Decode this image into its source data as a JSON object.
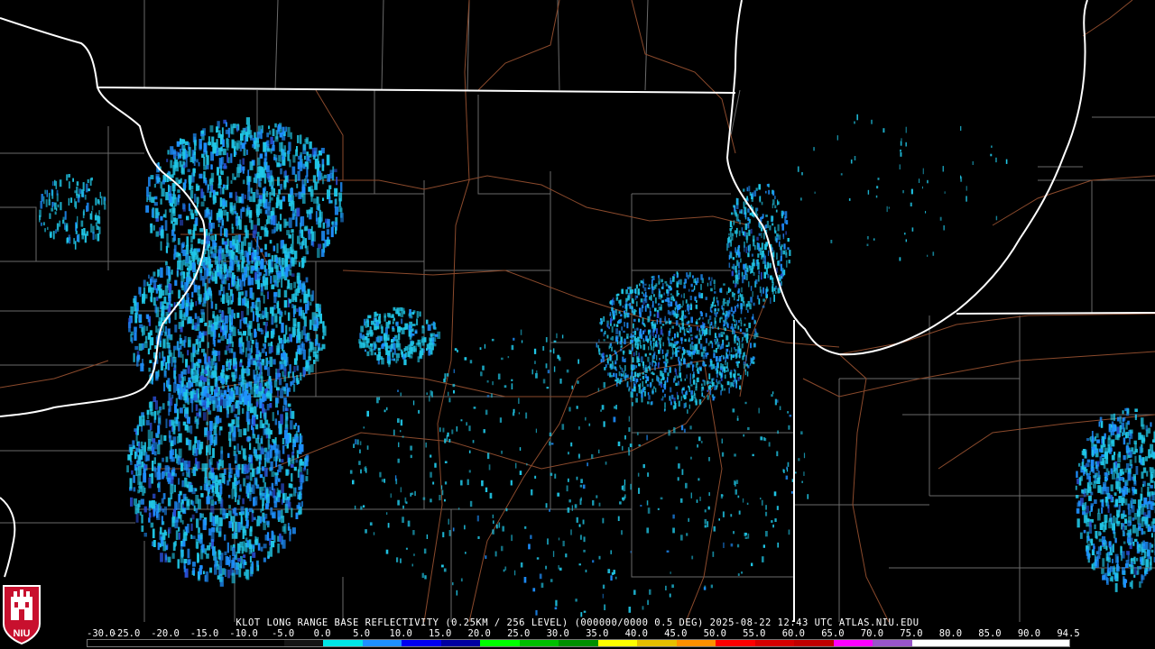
{
  "product": {
    "caption": "KLOT LONG RANGE BASE REFLECTIVITY (0.25KM / 256 LEVEL) (000000/0000 0.5 DEG) 2025-08-22 12:43 UTC  ATLAS.NIU.EDU",
    "station": "KLOT",
    "timestamp": "2025-08-22 12:43 UTC",
    "elevation_angle": "0.5 DEG",
    "source": "ATLAS.NIU.EDU"
  },
  "logo": {
    "text": "NIU",
    "icon": "niu-castle-logo",
    "color": "#c8102e"
  },
  "colors": {
    "background": "#000000",
    "state_border": "#ffffff",
    "shoreline": "#ffffff",
    "county_border": "#6a6a6a",
    "highway": "#8b4a2c",
    "echo_light": "#20c8e8",
    "echo_medium": "#1e90ff",
    "echo_dark": "#2a4fd6"
  },
  "legend": {
    "labels": [
      "-30.0",
      "-25.0",
      "-20.0",
      "-15.0",
      "-10.0",
      "-5.0",
      "0.0",
      "5.0",
      "10.0",
      "15.0",
      "20.0",
      "25.0",
      "30.0",
      "35.0",
      "40.0",
      "45.0",
      "50.0",
      "55.0",
      "60.0",
      "65.0",
      "70.0",
      "75.0",
      "80.0",
      "85.0",
      "90.0",
      "94.5"
    ],
    "colors": [
      "#000000",
      "#000000",
      "#000000",
      "#000000",
      "#000000",
      "#141414",
      "#00e6e6",
      "#1e90ff",
      "#0000f0",
      "#0000a0",
      "#00ff00",
      "#00c000",
      "#009000",
      "#ffff00",
      "#e6c000",
      "#ff9000",
      "#ff0000",
      "#d60000",
      "#c00000",
      "#ff00ff",
      "#9955c9",
      "#ffffff",
      "#ffffff",
      "#ffffff",
      "#ffffff"
    ]
  }
}
